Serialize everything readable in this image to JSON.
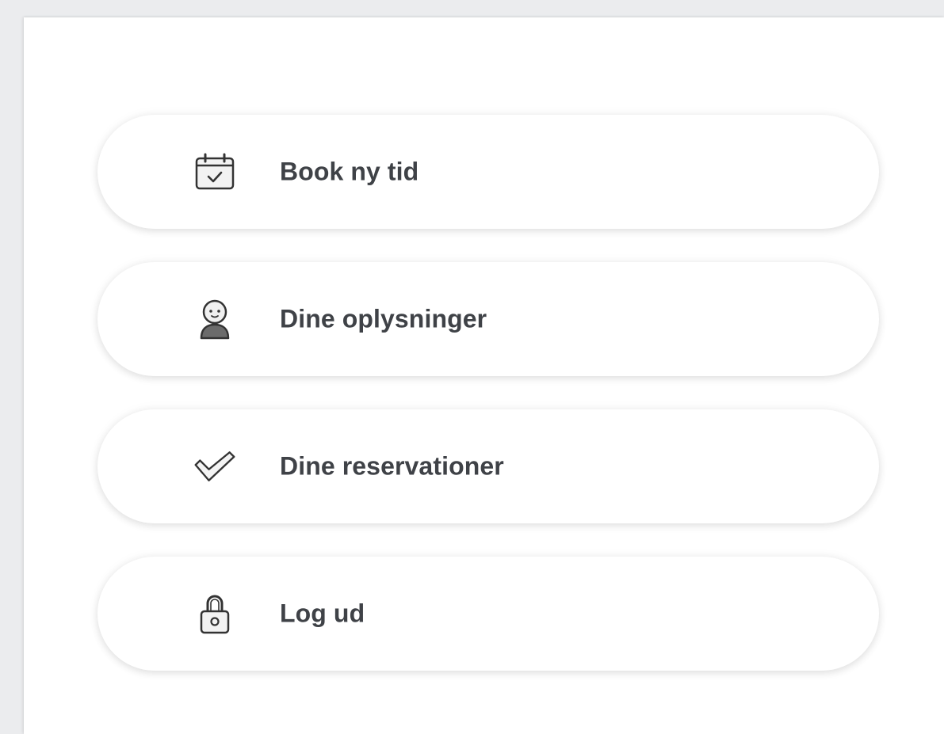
{
  "menu": {
    "items": [
      {
        "label": "Book ny tid",
        "icon": "calendar-check-icon"
      },
      {
        "label": "Dine oplysninger",
        "icon": "user-icon"
      },
      {
        "label": "Dine reservationer",
        "icon": "checkmark-icon"
      },
      {
        "label": "Log ud",
        "icon": "padlock-icon"
      }
    ]
  },
  "colors": {
    "background": "#ebecee",
    "panel": "#ffffff",
    "text": "#3f4247",
    "icon_stroke": "#333333"
  }
}
